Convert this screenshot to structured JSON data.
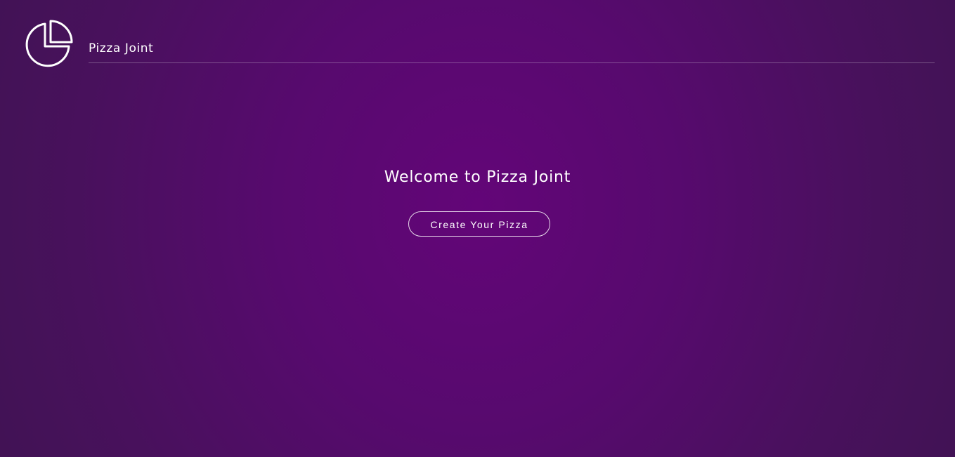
{
  "header": {
    "logo_icon": "pizza-slice-icon",
    "site_title": "Pizza Joint"
  },
  "hero": {
    "heading": "Welcome to Pizza Joint",
    "cta_label": "Create Your Pizza"
  },
  "colors": {
    "background_center": "#630578",
    "background_edge": "#3f1352",
    "text": "#ffffff"
  }
}
